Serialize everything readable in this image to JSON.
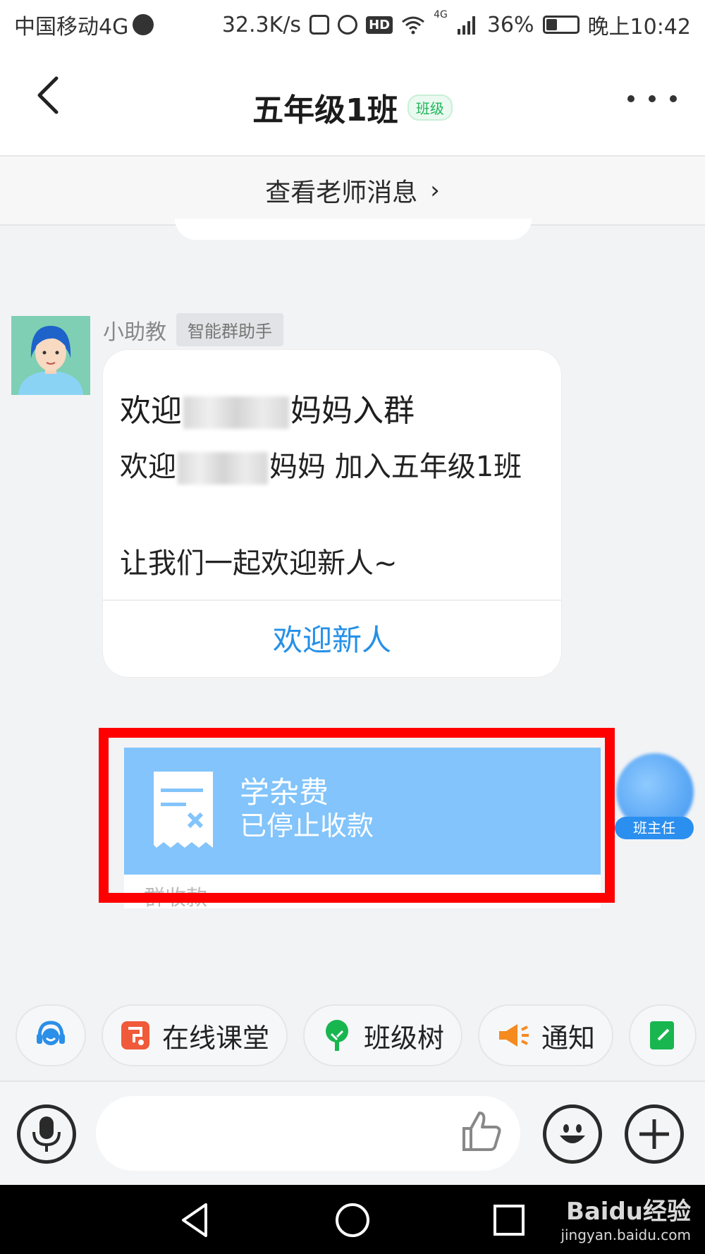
{
  "status_bar": {
    "carrier": "中国移动4G",
    "network_speed": "32.3K/s",
    "hd": "HD",
    "network_type": "4G",
    "battery": "36%",
    "battery_level": 0.36,
    "time": "晚上10:42"
  },
  "header": {
    "title": "五年级1班",
    "tag": "班级"
  },
  "teacher_strip": {
    "label": "查看老师消息",
    "chevron": "›"
  },
  "assistant_message": {
    "sender_name": "小助教",
    "sender_tag": "智能群助手",
    "line1_prefix": "欢迎",
    "line1_suffix": "妈妈入群",
    "line2_prefix": "欢迎",
    "line2_suffix": "妈妈 加入五年级1班",
    "line3": "让我们一起欢迎新人~",
    "action": "欢迎新人"
  },
  "payment_message": {
    "title": "学杂费",
    "status": "已停止收款",
    "footer_label": "群收款",
    "sender_badge": "班主任"
  },
  "tools": [
    {
      "label": "",
      "icon": "headset-icon",
      "color": "#2a8fe8"
    },
    {
      "label": "在线课堂",
      "icon": "online-class-icon",
      "color": "#f05a3a"
    },
    {
      "label": "班级树",
      "icon": "tree-icon",
      "color": "#19b64f"
    },
    {
      "label": "通知",
      "icon": "megaphone-icon",
      "color": "#f58a1f"
    },
    {
      "label": "",
      "icon": "homework-icon",
      "color": "#19b64f"
    }
  ],
  "input_bar": {
    "placeholder": ""
  },
  "watermark": {
    "brand": "Baidu经验",
    "url": "jingyan.baidu.com"
  },
  "colors": {
    "accent_blue": "#2590e8",
    "payment_card": "#82c4fb",
    "highlight_red": "#ff0000",
    "tag_green": "#1fb65a"
  }
}
